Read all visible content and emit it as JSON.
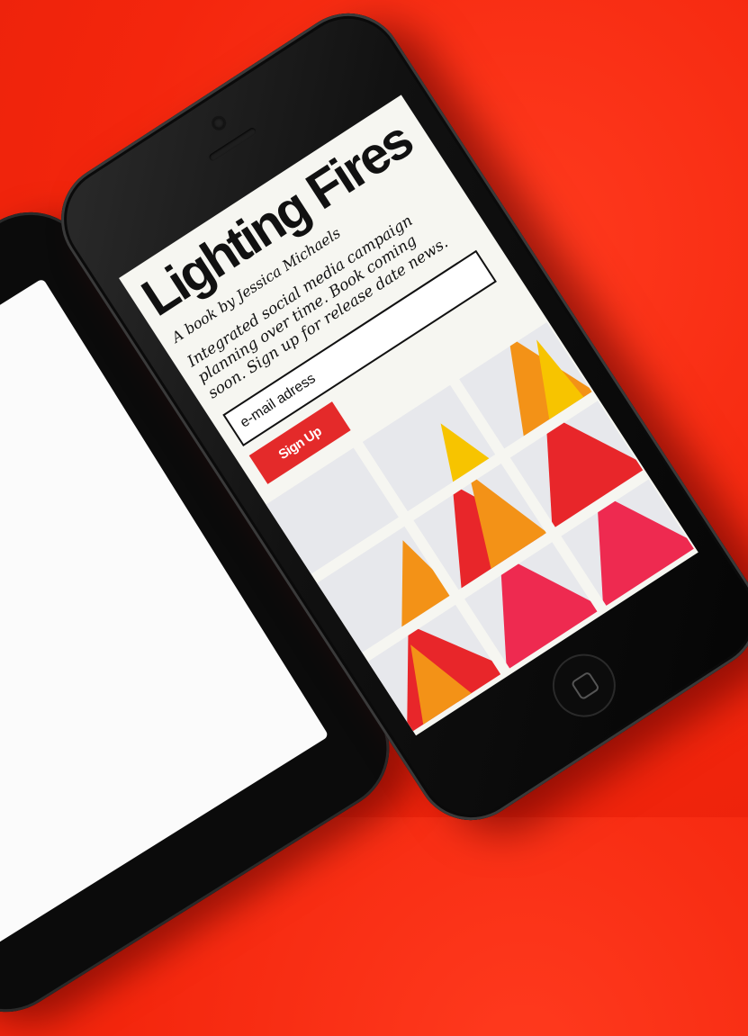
{
  "app": {
    "title": "Lighting Fires",
    "byline": "A book by Jessica Michaels",
    "description": "Integrated social media campaign planning over time. Book coming soon. Sign up for release date news."
  },
  "form": {
    "email_placeholder": "e-mail adress",
    "signup_label": "Sign Up"
  },
  "colors": {
    "background": "#f5280f",
    "accent_red": "#e42a2a",
    "flame_yellow": "#f7c400",
    "flame_orange": "#f39217",
    "flame_red": "#e8262a",
    "flame_pink": "#ee2a50",
    "tile_grey": "#e7e8ec"
  }
}
